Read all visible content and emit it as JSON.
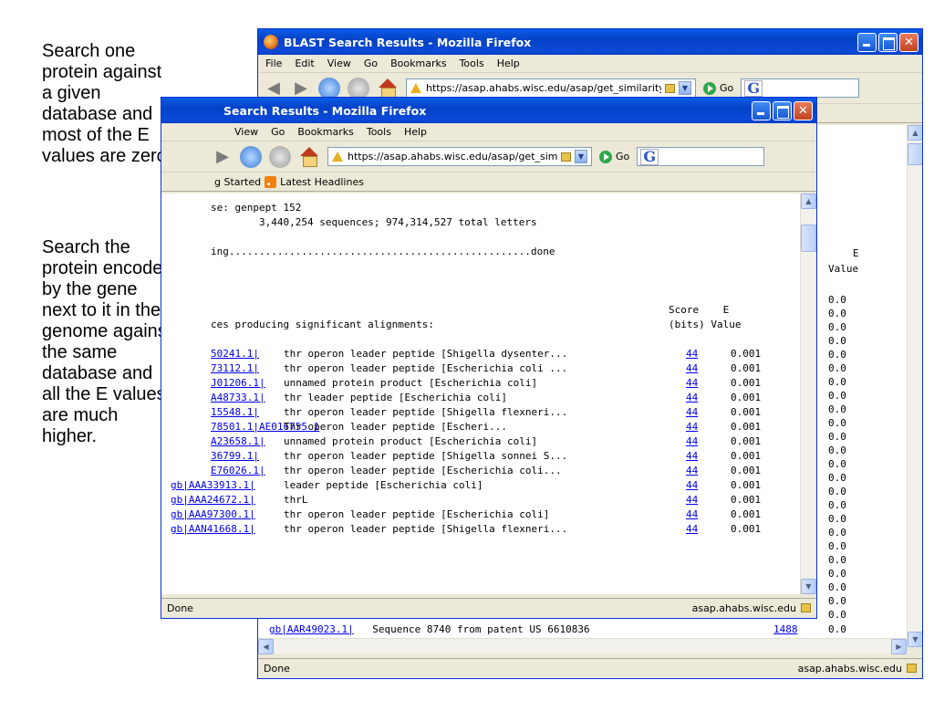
{
  "captions": {
    "first": [
      "Search one",
      "protein against",
      "a given",
      "database and",
      "most of the E",
      "values are zero"
    ],
    "second": [
      "Search the",
      "protein encoded",
      "by the gene",
      "next to it in the",
      "genome against",
      "the same",
      "database and",
      "all the E values",
      "are much",
      "higher."
    ]
  },
  "back_window": {
    "title": "BLAST Search Results - Mozilla Firefox",
    "menu": [
      "File",
      "Edit",
      "View",
      "Go",
      "Bookmarks",
      "Tools",
      "Help"
    ],
    "url": "https://asap.ahabs.wisc.edu/asap/get_similarity",
    "go_label": "Go",
    "col_header": [
      "E",
      "Value"
    ],
    "values": [
      "0.0",
      "0.0",
      "0.0",
      "0.0",
      "0.0",
      "0.0",
      "0.0",
      "0.0",
      "0.0",
      "0.0",
      "0.0",
      "0.0",
      "0.0",
      "0.0",
      "0.0",
      "0.0",
      "0.0",
      "0.0",
      "0.0",
      "0.0",
      "0.0",
      "0.0",
      "0.0",
      "0.0"
    ],
    "last_row": {
      "id": "gb|AAR49023.1|",
      "desc": "  Sequence 8740 from patent US 6610836",
      "score": "1488",
      "e": "0.0"
    },
    "status": "Done",
    "status_host": "asap.ahabs.wisc.edu"
  },
  "front_window": {
    "title": "Search Results - Mozilla Firefox",
    "menu": [
      "View",
      "Go",
      "Bookmarks",
      "Tools",
      "Help"
    ],
    "url": "https://asap.ahabs.wisc.edu/asap/get_similar",
    "go_label": "Go",
    "bookmarks": [
      "g Started",
      "Latest Headlines"
    ],
    "header_lines": [
      "se: genpept 152",
      "        3,440,254 sequences; 974,314,527 total letters",
      "",
      "ing..................................................done"
    ],
    "score_header": [
      "Score    E",
      "(bits) Value"
    ],
    "producing": "ces producing significant alignments:",
    "rows": [
      {
        "id": "50241.1|",
        "desc": "thr operon leader peptide [Shigella dysenter...",
        "score": "44",
        "e": "0.001"
      },
      {
        "id": "73112.1|",
        "desc": "thr operon leader peptide [Escherichia coli ...",
        "score": "44",
        "e": "0.001"
      },
      {
        "id": "J01206.1|",
        "desc": "unnamed protein product [Escherichia coli]",
        "score": "44",
        "e": "0.001"
      },
      {
        "id": "A48733.1|",
        "desc": "thr leader peptide [Escherichia coli]",
        "score": "44",
        "e": "0.001"
      },
      {
        "id": "15548.1|",
        "desc": "thr operon leader peptide [Shigella flexneri...",
        "score": "44",
        "e": "0.001"
      },
      {
        "id": "78501.1|AE016755 1",
        "desc": "Thr operon leader peptide [Escheri...",
        "score": "44",
        "e": "0.001"
      },
      {
        "id": "A23658.1|",
        "desc": "unnamed protein product [Escherichia coli]",
        "score": "44",
        "e": "0.001"
      },
      {
        "id": "36799.1|",
        "desc": "thr operon leader peptide [Shigella sonnei S...",
        "score": "44",
        "e": "0.001"
      },
      {
        "id": "E76026.1|",
        "desc": "thr operon leader peptide [Escherichia coli...",
        "score": "44",
        "e": "0.001"
      },
      {
        "id": "gb|AAA33913.1|",
        "desc": "leader peptide [Escherichia coli]",
        "score": "44",
        "e": "0.001"
      },
      {
        "id": "gb|AAA24672.1|",
        "desc": "thrL",
        "score": "44",
        "e": "0.001"
      },
      {
        "id": "gb|AAA97300.1|",
        "desc": "thr operon leader peptide [Escherichia coli]",
        "score": "44",
        "e": "0.001"
      },
      {
        "id": "gb|AAN41668.1|",
        "desc": "thr operon leader peptide [Shigella flexneri...",
        "score": "44",
        "e": "0.001"
      }
    ],
    "status": "Done",
    "status_host": "asap.ahabs.wisc.edu"
  }
}
